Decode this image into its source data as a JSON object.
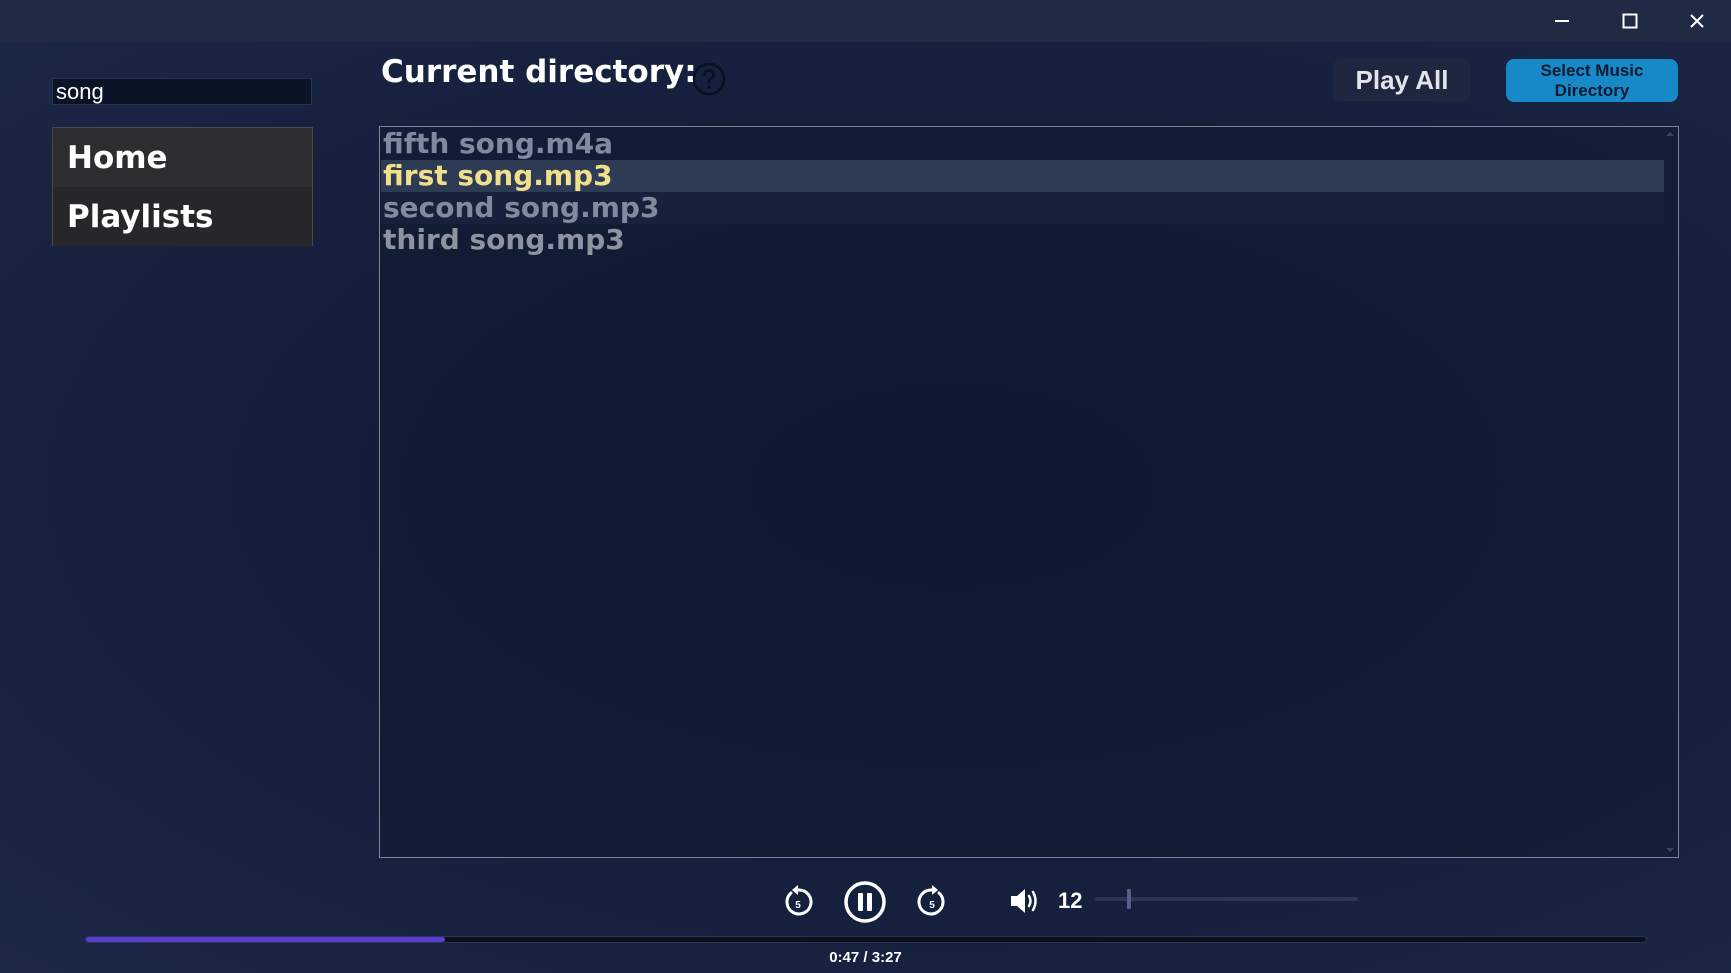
{
  "window_controls": {
    "minimize": "minimize",
    "maximize": "maximize",
    "close": "close"
  },
  "sidebar": {
    "search": {
      "value": "song",
      "placeholder": ""
    },
    "nav_items": [
      {
        "label": "Home"
      },
      {
        "label": "Playlists"
      }
    ]
  },
  "header": {
    "directory_label": "Current directory:",
    "help_icon": "question-circle-icon",
    "play_all_label": "Play All",
    "select_directory_label": "Select Music\nDirectory"
  },
  "files": [
    {
      "name": "fifth song.m4a",
      "state": "normal"
    },
    {
      "name": "first song.mp3",
      "state": "selected"
    },
    {
      "name": "second song.mp3",
      "state": "normal"
    },
    {
      "name": "third song.mp3",
      "state": "normal"
    }
  ],
  "player": {
    "rewind_icon": "rewind-5-icon",
    "pause_icon": "pause-icon",
    "forward_icon": "forward-5-icon",
    "volume_icon": "volume-icon",
    "volume": "12",
    "volume_fraction": 0.12,
    "progress_fraction": 0.23,
    "time": "0:47 / 3:27"
  },
  "colors": {
    "background": "#131f3b",
    "accent": "#1789c8",
    "selected_text": "#f0e08c",
    "progress": "#5b3fd2"
  }
}
